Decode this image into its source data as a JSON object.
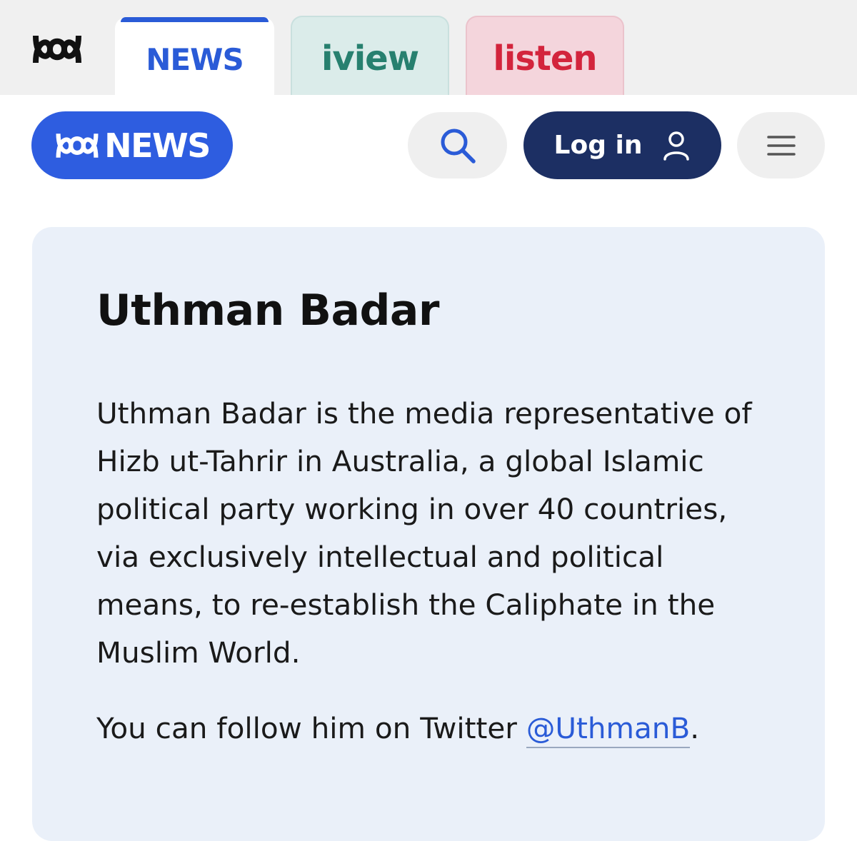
{
  "network_nav": {
    "tabs": [
      {
        "label": "NEWS",
        "active": true
      },
      {
        "label": "iview",
        "active": false
      },
      {
        "label": "listen",
        "active": false
      }
    ],
    "icons": {
      "logo": "abc-logo-icon"
    }
  },
  "header": {
    "brand_label": "NEWS",
    "search_icon": "search-icon",
    "login_label": "Log in",
    "login_icon": "user-icon",
    "menu_icon": "hamburger-menu-icon"
  },
  "author": {
    "name": "Uthman Badar",
    "bio": "Uthman Badar is the media representative of Hizb ut-Tahrir in Australia, a global Islamic political party working in over 40 countries, via exclusively intellectual and political means, to re-establish the Caliphate in the Muslim World.",
    "follow_prefix": "You can follow him on Twitter ",
    "twitter_handle": "@UthmanB",
    "follow_suffix": "."
  },
  "colors": {
    "news_blue": "#2e5de0",
    "login_navy": "#1c2f63",
    "iview_teal": "#27806f",
    "listen_red": "#d3243c",
    "card_bg": "#eaf0f9"
  }
}
